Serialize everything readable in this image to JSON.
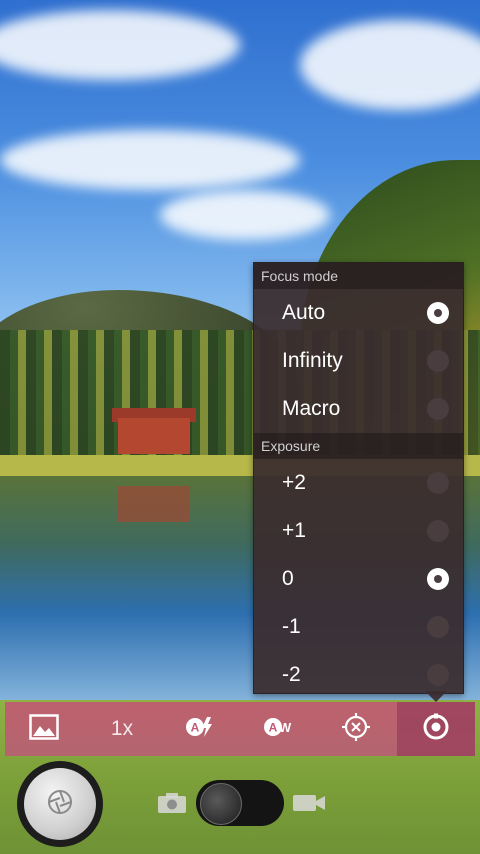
{
  "focus_mode": {
    "header": "Focus mode",
    "options": [
      {
        "label": "Auto",
        "selected": true
      },
      {
        "label": "Infinity",
        "selected": false
      },
      {
        "label": "Macro",
        "selected": false
      }
    ]
  },
  "exposure": {
    "header": "Exposure",
    "options": [
      {
        "label": "+2",
        "selected": false
      },
      {
        "label": "+1",
        "selected": false
      },
      {
        "label": "0",
        "selected": true
      },
      {
        "label": "-1",
        "selected": false
      },
      {
        "label": "-2",
        "selected": false
      }
    ]
  },
  "toolbar": {
    "zoom_label": "1x",
    "icons": [
      "gallery-icon",
      "auto-flash-icon",
      "auto-white-balance-icon",
      "exposure-target-icon",
      "settings-icon"
    ],
    "active": "settings-icon"
  },
  "colors": {
    "toolbar": "#c25a75",
    "popup": "#3a2c2e",
    "radio_selected": "#ffffff"
  }
}
